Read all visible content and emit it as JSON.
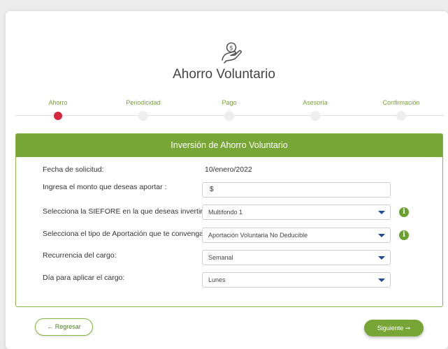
{
  "header": {
    "icon": "hand-coin-icon",
    "title": "Ahorro Voluntario"
  },
  "stepper": {
    "steps": [
      {
        "label": "Ahorro",
        "active": true
      },
      {
        "label": "Periodicidad",
        "active": false
      },
      {
        "label": "Pago",
        "active": false
      },
      {
        "label": "Asesoría",
        "active": false
      },
      {
        "label": "Confirmación",
        "active": false
      }
    ]
  },
  "form": {
    "title": "Inversión de Ahorro Voluntario",
    "fecha_label": "Fecha de solicitud:",
    "fecha_value": "10/enero/2022",
    "monto_label": "Ingresa el monto que deseas aportar :",
    "monto_value": "$",
    "siefore_label": "Selecciona la SIEFORE en la que deseas invertir :",
    "siefore_value": "Multifondo 1",
    "tipo_label": "Selecciona el tipo de Aportación que te convenga:",
    "tipo_value": "Aportación Voluntaria No Deducible",
    "recurrencia_label": "Recurrencia del cargo:",
    "recurrencia_value": "Semanal",
    "dia_label": "Día para aplicar el cargo:",
    "dia_value": "Lunes"
  },
  "actions": {
    "back_label": "← Regresar",
    "next_label": "Siguiente ➞"
  },
  "colors": {
    "accent_green": "#78a636",
    "active_step": "#d92640",
    "select_chevron": "#1f4aa0"
  }
}
